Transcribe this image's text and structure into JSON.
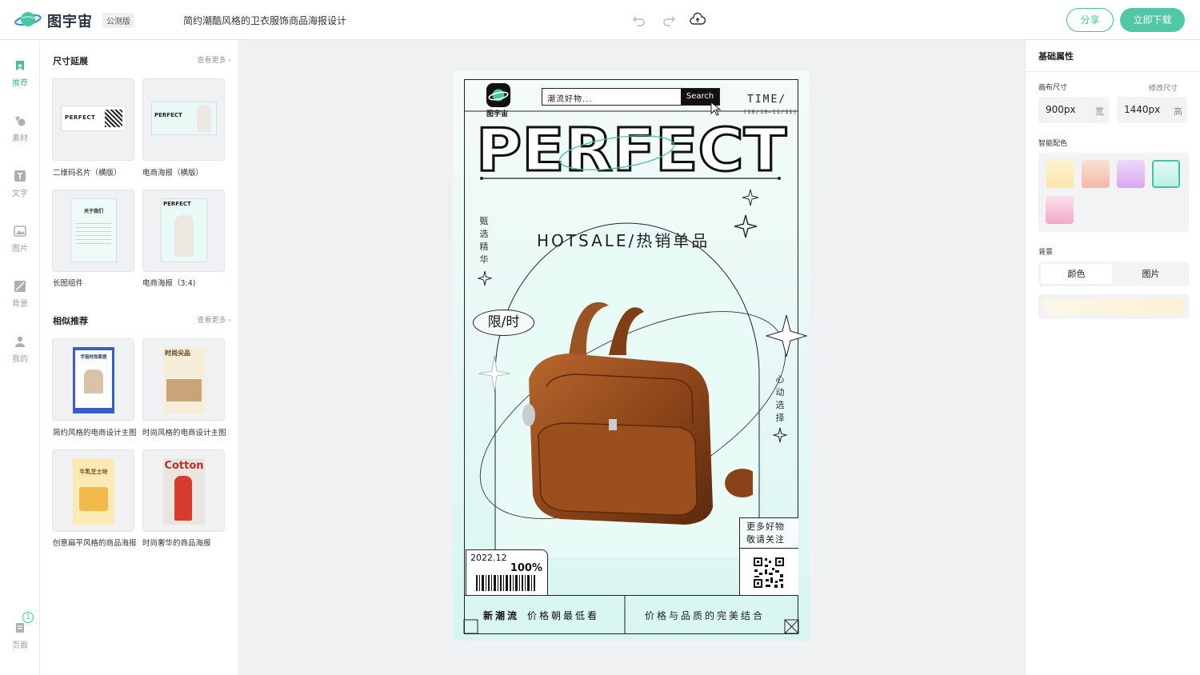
{
  "topbar": {
    "brand": "图宇宙",
    "edition": "公测版",
    "doc_title": "简约潮酷风格的卫衣服饰商品海报设计",
    "share_label": "分享",
    "download_label": "立即下载",
    "icons": [
      "undo-icon",
      "redo-icon",
      "cloud-save-icon"
    ]
  },
  "rail": {
    "items": [
      {
        "label": "推荐",
        "icon": "recommend-icon",
        "active": true
      },
      {
        "label": "素材",
        "icon": "shapes-icon"
      },
      {
        "label": "文字",
        "icon": "text-icon"
      },
      {
        "label": "图片",
        "icon": "image-icon"
      },
      {
        "label": "背景",
        "icon": "background-icon"
      },
      {
        "label": "我的",
        "icon": "user-icon"
      }
    ],
    "pages": {
      "label": "页面",
      "count": "1"
    }
  },
  "left_panel": {
    "sections": [
      {
        "title": "尺寸延展",
        "more": "查看更多",
        "cards": [
          {
            "caption": "二维码名片（横版）"
          },
          {
            "caption": "电商海报（横版）"
          },
          {
            "caption": "长图组件"
          },
          {
            "caption": "电商海报（3:4)"
          }
        ]
      },
      {
        "title": "相似推荐",
        "more": "查看更多",
        "cards": [
          {
            "caption": "简约风格的电商设计主图"
          },
          {
            "caption": "时尚风格的电商设计主图"
          },
          {
            "caption": "创意扁平风格的商品海报"
          },
          {
            "caption": "时尚奢华的商品海报"
          }
        ]
      }
    ],
    "thumb_text": {
      "perfect": "PERFECT",
      "about": "关于我们",
      "furniture": "宇宙时尚家居",
      "fashion": "时尚尖品",
      "cheese": "牛乳芝士块",
      "cotton": "Cotton"
    }
  },
  "poster": {
    "logo_text": "图宇宙",
    "search_placeholder": "潮流好物...",
    "search_button": "Search",
    "time_label": "TIME/",
    "date_range": "(10/10—11/11)",
    "headline": "PERFECT",
    "subheadline": "HOTSALE/热销单品",
    "vertical_left": "甄选精华",
    "vertical_right": "心动选择",
    "limited": "限/时",
    "more_goods": [
      "更多好物",
      "敬请关注"
    ],
    "ticket_date": "2022.12",
    "ticket_percent": "100%",
    "bottom_left_bold": "新潮流",
    "bottom_left": "价格朝最低看",
    "bottom_right": "价格与品质的完美结合"
  },
  "right_panel": {
    "title": "基础属性",
    "canvas_size_label": "画布尺寸",
    "resize_label": "修改尺寸",
    "width_value": "900px",
    "width_unit": "宽",
    "height_value": "1440px",
    "height_unit": "高",
    "smart_color_label": "智能配色",
    "swatches": [
      "#fdf0c9",
      "#f9d6cc",
      "#e6cbf3",
      "#d6f6ef",
      "#f6cfe0"
    ],
    "selected_swatch": 3,
    "background_label": "背景",
    "bg_tabs": [
      "颜色",
      "图片"
    ],
    "bg_active": 0
  },
  "colors": {
    "accent": "#43c19b",
    "poster_mint": "#d8f6f0"
  }
}
